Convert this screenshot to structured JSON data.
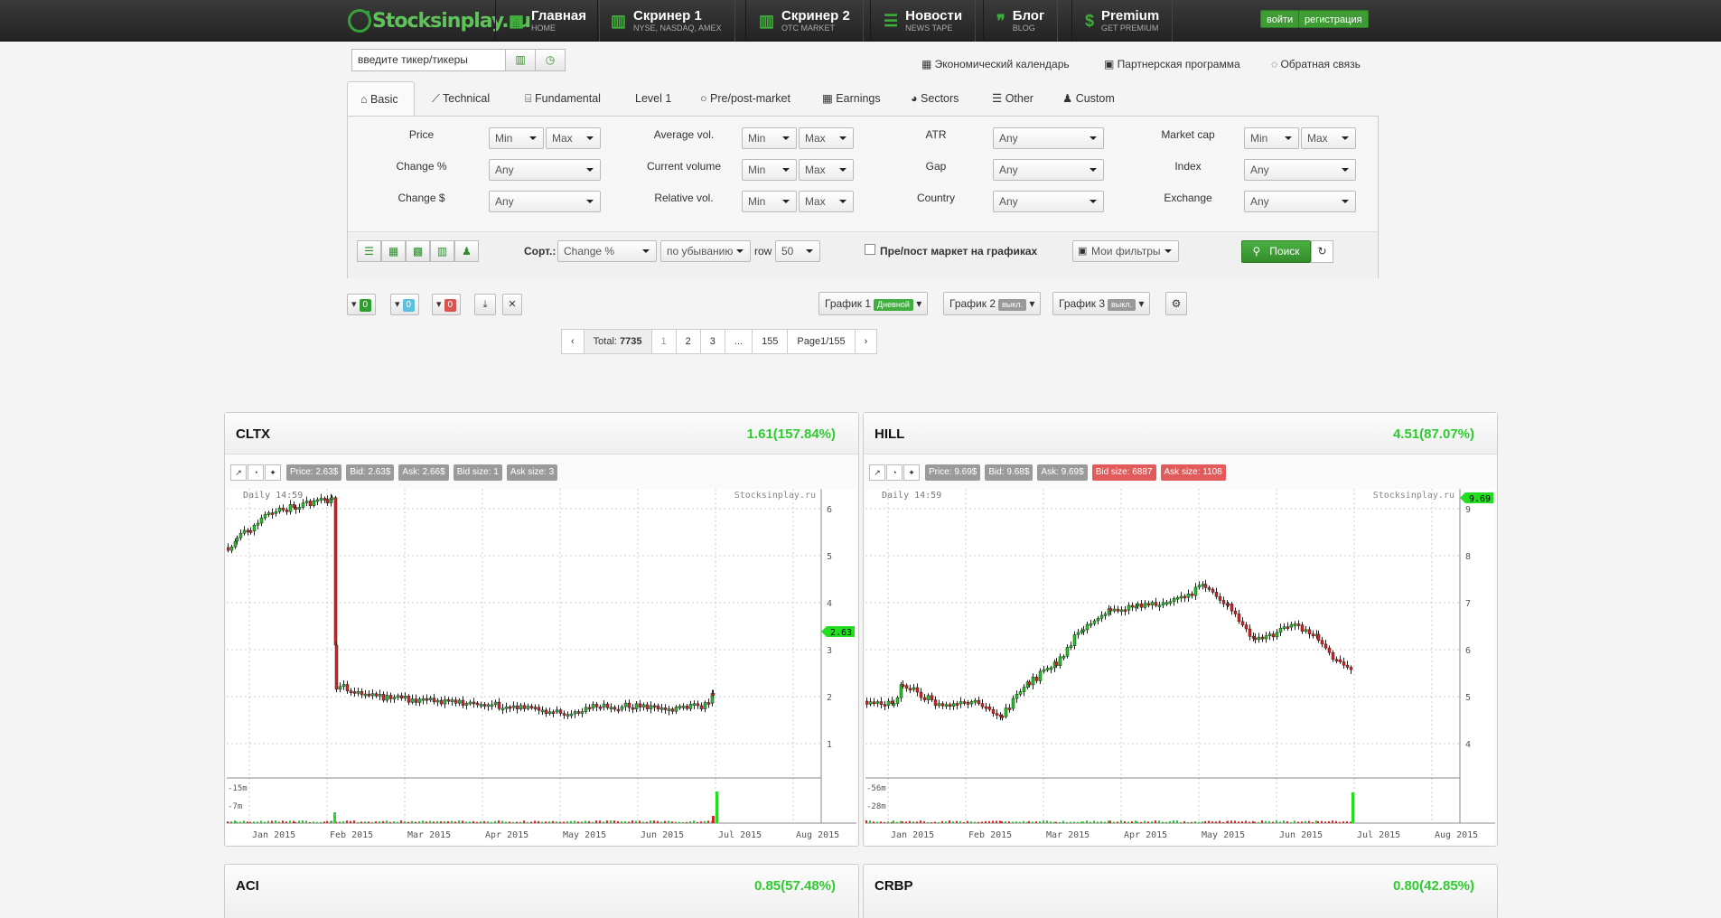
{
  "nav": {
    "logo": "Stocksinplay.ru",
    "items": [
      {
        "title": "Главная",
        "sub": "HOME"
      },
      {
        "title": "Скринер 1",
        "sub": "NYSE, NASDAQ, AMEX"
      },
      {
        "title": "Скринер 2",
        "sub": "OTC MARKET"
      },
      {
        "title": "Новости",
        "sub": "NEWS TAPE"
      },
      {
        "title": "Блог",
        "sub": "BLOG"
      },
      {
        "title": "Premium",
        "sub": "GET PREMIUM"
      }
    ],
    "login": "войти",
    "register": "регистрация"
  },
  "search": {
    "placeholder": "введите тикер/тикеры"
  },
  "toplinks": [
    "Экономический календарь",
    "Партнерская программа",
    "Обратная связь"
  ],
  "tabs": [
    "Basic",
    "Technical",
    "Fundamental",
    "Level 1",
    "Pre/post-market",
    "Earnings",
    "Sectors",
    "Other",
    "Custom"
  ],
  "filters": {
    "price": "Price",
    "avg_vol": "Average vol.",
    "atr": "ATR",
    "market_cap": "Market cap",
    "change_pct": "Change %",
    "cur_vol": "Current volume",
    "gap": "Gap",
    "index": "Index",
    "change_usd": "Change $",
    "rel_vol": "Relative vol.",
    "country": "Country",
    "exchange": "Exchange",
    "min": "Min",
    "max": "Max",
    "any": "Any"
  },
  "toolbar": {
    "sort_label": "Сорт.:",
    "sort_value": "Change %",
    "order_value": "по убыванию",
    "row_label": "row",
    "row_value": "50",
    "prepost": "Пре/пост маркет на графиках",
    "my_filters": "Мои фильтры",
    "search": "Поиск"
  },
  "counts": {
    "green": "0",
    "blue": "0",
    "red": "0"
  },
  "chartbtns": [
    {
      "label": "График 1",
      "badge": "Дневной"
    },
    {
      "label": "График 2",
      "badge": "выкл."
    },
    {
      "label": "График 3",
      "badge": "выкл."
    }
  ],
  "pager": {
    "total_label": "Total:",
    "total": "7735",
    "pages": [
      "1",
      "2",
      "3",
      "...",
      "155"
    ],
    "page_info": "Page1/155"
  },
  "cards": [
    {
      "ticker": "CLTX",
      "change": "1.61(157.84%)",
      "price": "Price: 2.63$",
      "bid": "Bid: 2.63$",
      "ask": "Ask: 2.66$",
      "bidsize": "Bid size: 1",
      "asksize": "Ask size: 3",
      "period": "Daily",
      "time": "14:59",
      "watermark": "Stocksinplay.ru",
      "last": "2.63",
      "yticks": [
        "6",
        "5",
        "4",
        "3",
        "2",
        "1"
      ],
      "vticks": [
        "15m",
        "7m"
      ]
    },
    {
      "ticker": "HILL",
      "change": "4.51(87.07%)",
      "price": "Price: 9.69$",
      "bid": "Bid: 9.68$",
      "ask": "Ask: 9.69$",
      "bidsize": "Bid size: 6887",
      "asksize": "Ask size: 1108",
      "period": "Daily",
      "time": "14:59",
      "watermark": "Stocksinplay.ru",
      "last": "9.69",
      "yticks": [
        "9",
        "8",
        "7",
        "6",
        "5",
        "4"
      ],
      "vticks": [
        "56m",
        "28m"
      ]
    },
    {
      "ticker": "ACI",
      "change": "0.85(57.48%)"
    },
    {
      "ticker": "CRBP",
      "change": "0.80(42.85%)"
    }
  ],
  "xticks": [
    "Jan 2015",
    "Feb 2015",
    "Mar 2015",
    "Apr 2015",
    "May 2015",
    "Jun 2015",
    "Jul 2015",
    "Aug 2015"
  ],
  "colors": {
    "up": "#2bbf2b",
    "down": "#d42424",
    "brand": "#3fae3c"
  }
}
